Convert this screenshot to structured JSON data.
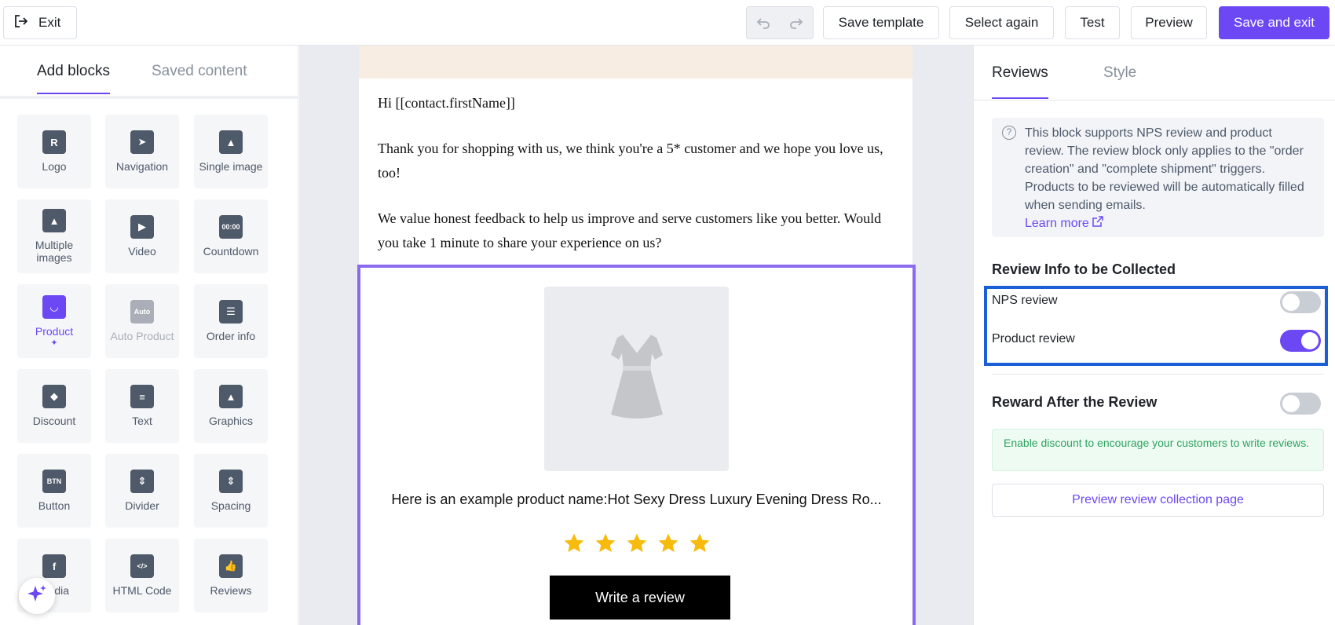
{
  "topbar": {
    "exit_label": "Exit",
    "save_template_label": "Save template",
    "select_again_label": "Select again",
    "test_label": "Test",
    "preview_label": "Preview",
    "save_exit_label": "Save and exit"
  },
  "left_panel": {
    "tabs": [
      "Add blocks",
      "Saved content"
    ],
    "blocks": [
      {
        "label": "Logo",
        "icon": "logo-icon",
        "glyph": "R"
      },
      {
        "label": "Navigation",
        "icon": "navigation-icon",
        "glyph": "➤"
      },
      {
        "label": "Single image",
        "icon": "image-icon",
        "glyph": "▲"
      },
      {
        "label": "Multiple images",
        "icon": "images-icon",
        "glyph": "▲"
      },
      {
        "label": "Video",
        "icon": "video-icon",
        "glyph": "▶"
      },
      {
        "label": "Countdown",
        "icon": "countdown-icon",
        "glyph": "00:00"
      },
      {
        "label": "Product",
        "icon": "product-icon",
        "glyph": "◡"
      },
      {
        "label": "Auto Product",
        "icon": "auto-product-icon",
        "glyph": "Auto"
      },
      {
        "label": "Order info",
        "icon": "order-info-icon",
        "glyph": "☰"
      },
      {
        "label": "Discount",
        "icon": "discount-icon",
        "glyph": "◆"
      },
      {
        "label": "Text",
        "icon": "text-icon",
        "glyph": "≡"
      },
      {
        "label": "Graphics",
        "icon": "graphics-icon",
        "glyph": "▲"
      },
      {
        "label": "Button",
        "icon": "button-icon",
        "glyph": "BTN"
      },
      {
        "label": "Divider",
        "icon": "divider-icon",
        "glyph": "⇕"
      },
      {
        "label": "Spacing",
        "icon": "spacing-icon",
        "glyph": "⇕"
      },
      {
        "label": "media",
        "icon": "social-media-icon",
        "glyph": "f"
      },
      {
        "label": "HTML Code",
        "icon": "html-code-icon",
        "glyph": "</>"
      },
      {
        "label": "Reviews",
        "icon": "reviews-icon",
        "glyph": "👍"
      }
    ]
  },
  "email": {
    "greeting": "Hi [[contact.firstName]]",
    "paragraph1": "Thank you for shopping with us, we think you're a 5* customer and we hope you love us, too!",
    "paragraph2": "We value honest feedback to help us improve and serve customers like you better. Would you take 1 minute to share your experience on us?",
    "product_name": "Here is an example product name:Hot Sexy Dress Luxury Evening Dress Ro...",
    "star_count": 5,
    "write_review_label": "Write a review"
  },
  "right_panel": {
    "tabs": [
      "Reviews",
      "Style"
    ],
    "info_text": "This block supports NPS review and product review. The review block only applies to the \"order creation\" and \"complete shipment\" triggers. Products to be reviewed will be automatically filled when sending emails.",
    "learn_more_label": "Learn more",
    "review_info_title": "Review Info to be Collected",
    "nps_label": "NPS review",
    "nps_on": false,
    "product_review_label": "Product review",
    "product_review_on": true,
    "reward_title": "Reward After the Review",
    "reward_on": false,
    "reward_hint": "Enable discount to encourage your customers to write reviews.",
    "preview_link_label": "Preview review collection page"
  },
  "colors": {
    "accent": "#6c48f5",
    "highlight": "#1a5fd6",
    "star": "#f7bb0e"
  }
}
